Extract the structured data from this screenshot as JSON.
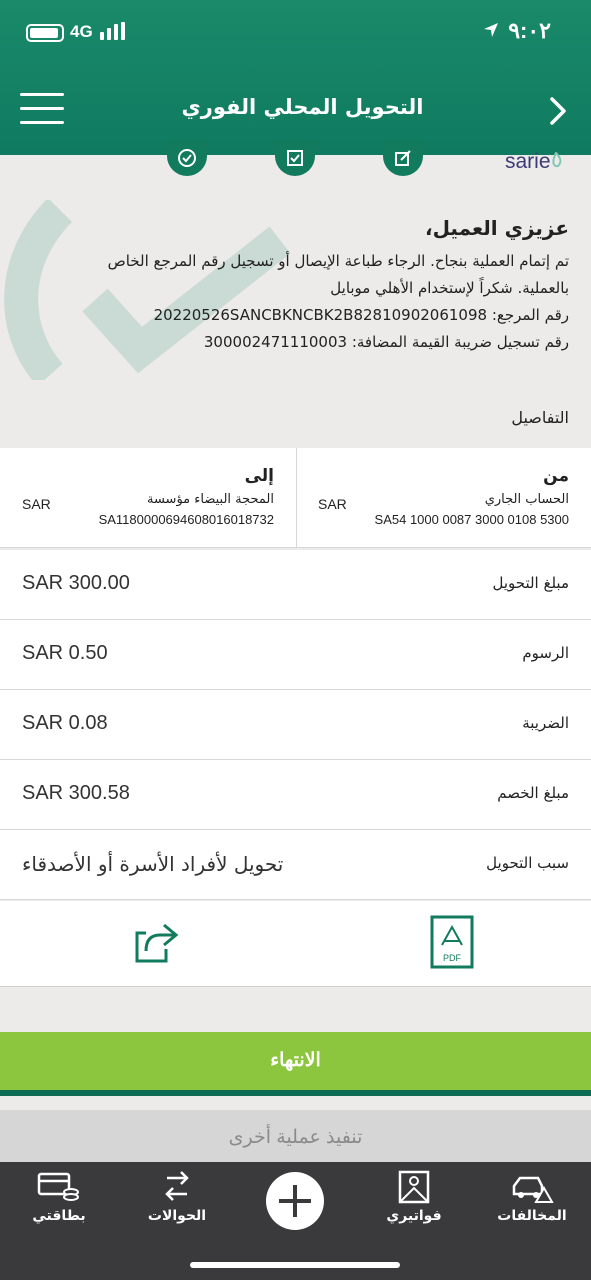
{
  "status_bar": {
    "time": "٩:٠٢",
    "network": "4G"
  },
  "header": {
    "title": "التحويل المحلي الفوري"
  },
  "brand": {
    "logo_text": "sarie"
  },
  "message": {
    "heading": "عزيزي العميل،",
    "line1": "تم إتمام العملية بنجاح. الرجاء طباعة الإيصال أو تسجيل رقم المرجع الخاص",
    "line2": "بالعملية. شكراً لإستخدام الأهلي موبايل",
    "line3": "رقم المرجع: 20220526SANCBKNCBK2B82810902061098",
    "line4": "رقم تسجيل ضريبة القيمة المضافة: 300002471110003"
  },
  "details_label": "التفاصيل",
  "from": {
    "title": "من",
    "name": "الحساب الجاري",
    "currency": "SAR",
    "iban": "SA54 1000 0087 3000 0108 5300"
  },
  "to": {
    "title": "إلى",
    "name": "المحجة البيضاء مؤسسة",
    "currency": "SAR",
    "iban": "SA1180000694608016018732"
  },
  "rows": {
    "amount": {
      "label": "مبلغ التحويل",
      "value": "SAR 300.00"
    },
    "fees": {
      "label": "الرسوم",
      "value": "SAR 0.50"
    },
    "vat": {
      "label": "الضريبة",
      "value": "SAR 0.08"
    },
    "debit": {
      "label": "مبلغ الخصم",
      "value": "SAR 300.58"
    },
    "reason": {
      "label": "سبب التحويل",
      "value": "تحويل لأفراد الأسرة أو الأصدقاء"
    }
  },
  "actions": {
    "pdf_text": "PDF",
    "share_icon": "share-icon",
    "pdf_icon": "pdf-icon"
  },
  "buttons": {
    "done": "الانتهاء",
    "another": "تنفيذ عملية أخرى"
  },
  "nav": {
    "cards": "بطاقتي",
    "transfers": "الحوالات",
    "bills": "فواتيري",
    "violations": "المخالفات"
  },
  "colors": {
    "header": "#127a5d",
    "accent": "#8cc63e",
    "nav": "#3a3a3c"
  }
}
